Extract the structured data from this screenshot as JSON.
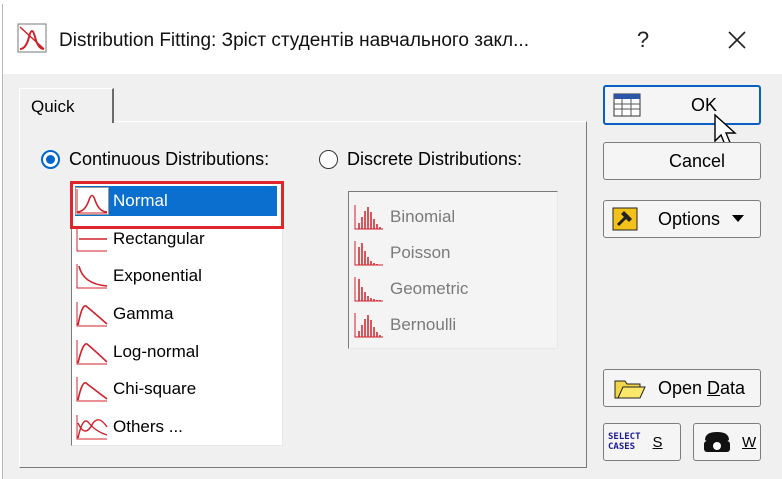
{
  "window": {
    "title": "Distribution Fitting: Зріст студентів навчального закл...",
    "help_label": "?",
    "close_label": "close"
  },
  "tabs": [
    {
      "label": "Quick"
    }
  ],
  "continuous": {
    "label": "Continuous Distributions:",
    "selected": true,
    "items": [
      {
        "label": "Normal",
        "icon": "normal-curve-icon",
        "selected": true
      },
      {
        "label": "Rectangular",
        "icon": "rectangular-icon"
      },
      {
        "label": "Exponential",
        "icon": "exponential-curve-icon"
      },
      {
        "label": "Gamma",
        "icon": "gamma-curve-icon"
      },
      {
        "label": "Log-normal",
        "icon": "log-normal-curve-icon"
      },
      {
        "label": "Chi-square",
        "icon": "chi-square-curve-icon"
      },
      {
        "label": "Others ...",
        "icon": "others-curves-icon"
      }
    ]
  },
  "discrete": {
    "label": "Discrete Distributions:",
    "selected": false,
    "items": [
      {
        "label": "Binomial",
        "icon": "binomial-bars-icon"
      },
      {
        "label": "Poisson",
        "icon": "poisson-bars-icon"
      },
      {
        "label": "Geometric",
        "icon": "geometric-bars-icon"
      },
      {
        "label": "Bernoulli",
        "icon": "bernoulli-bars-icon"
      }
    ]
  },
  "buttons": {
    "ok": "OK",
    "cancel": "Cancel",
    "options": "Options",
    "open_data_pre": "Open ",
    "open_data_key": "D",
    "open_data_post": "ata",
    "select_cases_icon_top": "SELECT",
    "select_cases_icon_bottom": "CASES",
    "select_cases_key": "S",
    "weight_key": "W"
  },
  "colors": {
    "accent": "#0a6fcf",
    "highlight_frame": "#e0252b",
    "curve": "#d0202a"
  }
}
